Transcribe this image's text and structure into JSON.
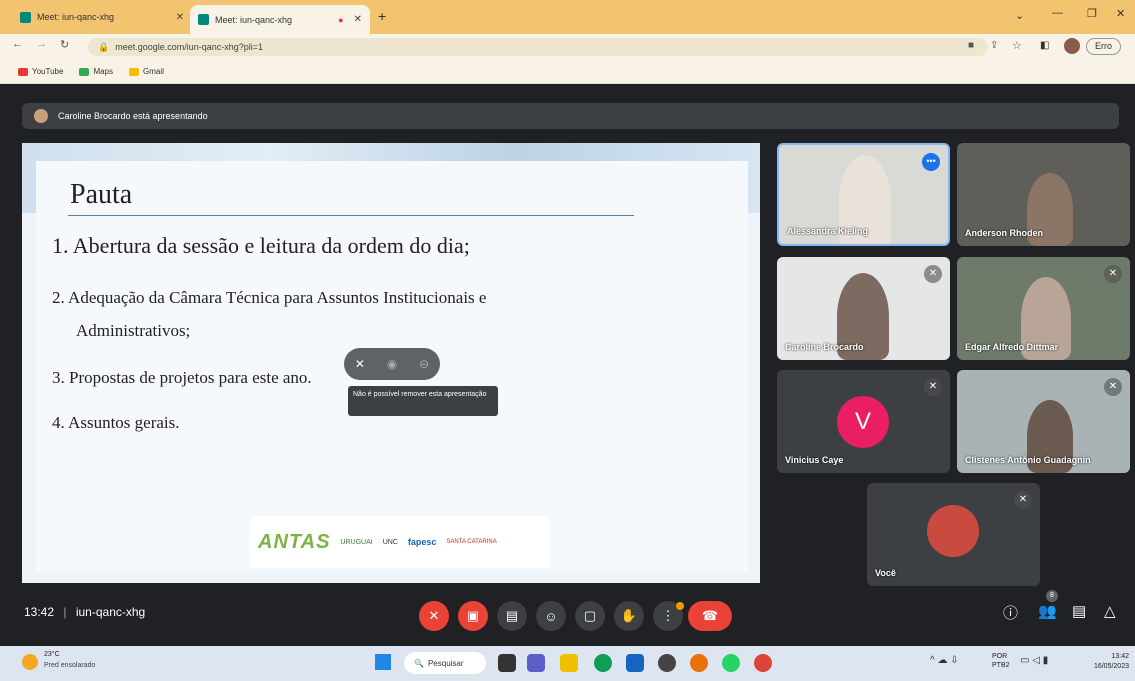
{
  "browser": {
    "tabs": [
      {
        "title": "Meet: iun-qanc-xhg"
      },
      {
        "title": "Meet: iun-qanc-xhg"
      }
    ],
    "new_tab": "+",
    "url": "meet.google.com/iun-qanc-xhg?pli=1",
    "profile_label": "Erro",
    "bookmarks": [
      "YouTube",
      "Maps",
      "Gmail"
    ]
  },
  "meet": {
    "presenting_text": "Caroline Brocardo está apresentando",
    "slide": {
      "title": "Pauta",
      "items": [
        "1. Abertura da sessão e leitura da ordem do dia;",
        "2. Adequação da Câmara Técnica para Assuntos Institucionais e",
        "Administrativos;",
        "3. Propostas de projetos para este ano.",
        "4. Assuntos gerais."
      ],
      "logos": [
        "ANTAS",
        "URUGUAI",
        "UNC",
        "fapesc",
        "SANTA CATARINA"
      ]
    },
    "tooltip": "Não é possível remover esta apresentação",
    "participants": [
      {
        "name": "Alessandra Kieling",
        "avatar": ""
      },
      {
        "name": "Anderson Rhoden",
        "avatar": ""
      },
      {
        "name": "Caroline Brocardo",
        "avatar": ""
      },
      {
        "name": "Edgar Alfredo Dittmar",
        "avatar": ""
      },
      {
        "name": "Vinicius Caye",
        "avatar": "V"
      },
      {
        "name": "Clistenes Antônio Guadagnin",
        "avatar": ""
      },
      {
        "name": "Você",
        "avatar": ""
      }
    ],
    "meeting_time": "13:42",
    "meeting_code": "iun-qanc-xhg",
    "people_count": "8",
    "accent": "#8ab4f8",
    "danger": "#ea4335"
  },
  "taskbar": {
    "weather_temp": "23°C",
    "weather_desc": "Pred ensolarado",
    "search": "Pesquisar",
    "lang": "POR",
    "layout": "PTB2",
    "time": "13:42",
    "date": "16/05/2023"
  }
}
